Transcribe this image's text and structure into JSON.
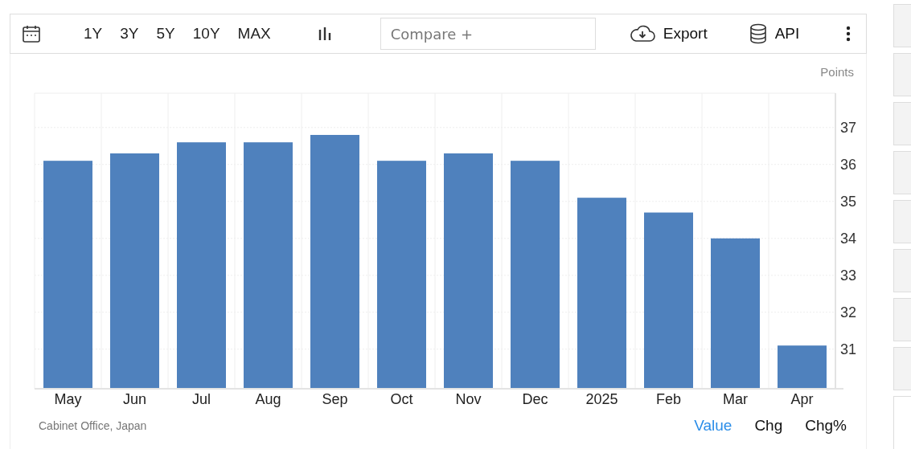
{
  "toolbar": {
    "ranges": [
      {
        "label": "1Y",
        "selected": false
      },
      {
        "label": "3Y",
        "selected": false
      },
      {
        "label": "5Y",
        "selected": false
      },
      {
        "label": "10Y",
        "selected": false
      },
      {
        "label": "MAX",
        "selected": false
      }
    ],
    "compare": {
      "placeholder": "Compare +"
    },
    "export": "Export",
    "api": "API"
  },
  "chart": {
    "unit": "Points",
    "chart_data": {
      "type": "bar",
      "categories": [
        "May",
        "Jun",
        "Jul",
        "Aug",
        "Sep",
        "Oct",
        "Nov",
        "Dec",
        "2025",
        "Feb",
        "Mar",
        "Apr"
      ],
      "series": [
        {
          "color": "#4f81bd",
          "values": [
            36.1,
            36.3,
            36.6,
            36.6,
            36.8,
            36.1,
            36.3,
            36.1,
            35.1,
            34.7,
            34.0,
            31.1
          ]
        }
      ],
      "ylim": [
        29.93,
        37.93
      ],
      "grid": true,
      "yticks": [
        31,
        32,
        33,
        34,
        35,
        36,
        37
      ]
    }
  },
  "footer": {
    "source": "Cabinet Office, Japan",
    "views": [
      {
        "label": "Value",
        "selected": true
      },
      {
        "label": "Chg",
        "selected": false
      },
      {
        "label": "Chg%",
        "selected": false
      }
    ]
  }
}
